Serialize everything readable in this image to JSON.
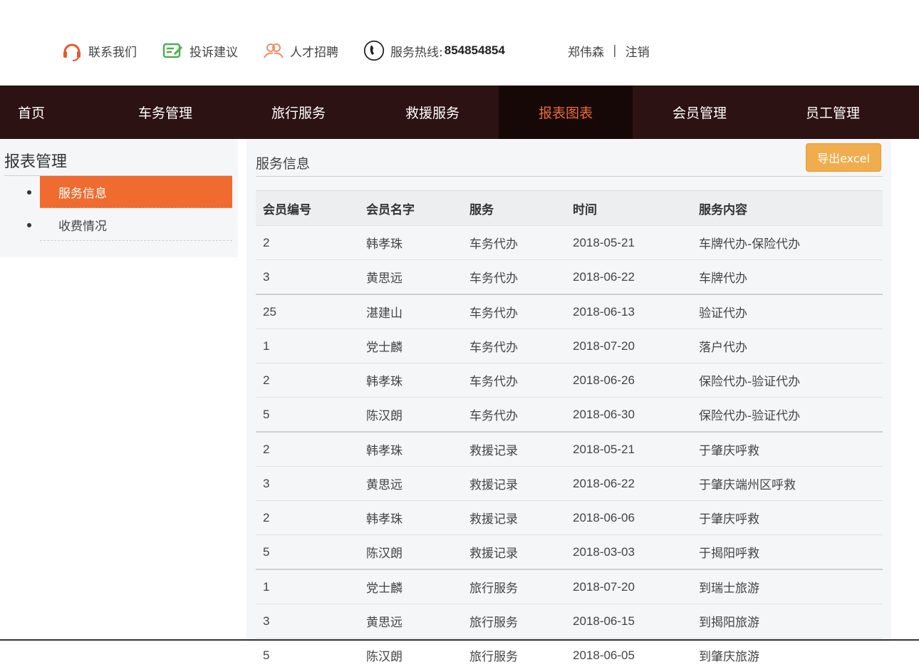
{
  "topbar": {
    "contact_label": "联系我们",
    "complaint_label": "投诉建议",
    "recruit_label": "人才招聘",
    "hotline_label": "服务热线:",
    "hotline_number": "854854854",
    "user_name": "郑伟森",
    "separator": "|",
    "logout_label": "注销"
  },
  "nav": {
    "items": [
      "首页",
      "车务管理",
      "旅行服务",
      "救援服务",
      "报表图表",
      "会员管理",
      "员工管理"
    ],
    "active_index": 4
  },
  "sidebar": {
    "title": "报表管理",
    "items": [
      "服务信息",
      "收费情况"
    ],
    "active_index": 0
  },
  "main": {
    "title": "服务信息",
    "export_label": "导出excel",
    "columns": [
      "会员编号",
      "会员名字",
      "服务",
      "时间",
      "服务内容"
    ],
    "rows": [
      [
        "2",
        "韩孝珠",
        "车务代办",
        "2018-05-21",
        "车牌代办-保险代办"
      ],
      [
        "3",
        "黄思远",
        "车务代办",
        "2018-06-22",
        "车牌代办"
      ],
      [
        "25",
        "湛建山",
        "车务代办",
        "2018-06-13",
        "验证代办"
      ],
      [
        "1",
        "党士麟",
        "车务代办",
        "2018-07-20",
        "落户代办"
      ],
      [
        "2",
        "韩孝珠",
        "车务代办",
        "2018-06-26",
        "保险代办-验证代办"
      ],
      [
        "5",
        "陈汉朗",
        "车务代办",
        "2018-06-30",
        "保险代办-验证代办"
      ],
      [
        "2",
        "韩孝珠",
        "救援记录",
        "2018-05-21",
        "于肇庆呼救"
      ],
      [
        "3",
        "黄思远",
        "救援记录",
        "2018-06-22",
        "于肇庆端州区呼救"
      ],
      [
        "2",
        "韩孝珠",
        "救援记录",
        "2018-06-06",
        "于肇庆呼救"
      ],
      [
        "5",
        "陈汉朗",
        "救援记录",
        "2018-03-03",
        "于揭阳呼救"
      ],
      [
        "1",
        "党士麟",
        "旅行服务",
        "2018-07-20",
        "到瑞士旅游"
      ],
      [
        "3",
        "黄思远",
        "旅行服务",
        "2018-06-15",
        "到揭阳旅游"
      ],
      [
        "5",
        "陈汉朗",
        "旅行服务",
        "2018-06-05",
        "到肇庆旅游"
      ]
    ]
  },
  "colors": {
    "nav_bg": "#2c1212",
    "nav_active_bg": "#170808",
    "accent": "#ef6b35",
    "export_btn": "#f0ad4e",
    "panel_bg": "#f4f6f8"
  },
  "icons": {
    "contact": "headset-icon",
    "complaint": "edit-note-icon",
    "recruit": "people-icon",
    "hotline": "phone-icon"
  }
}
